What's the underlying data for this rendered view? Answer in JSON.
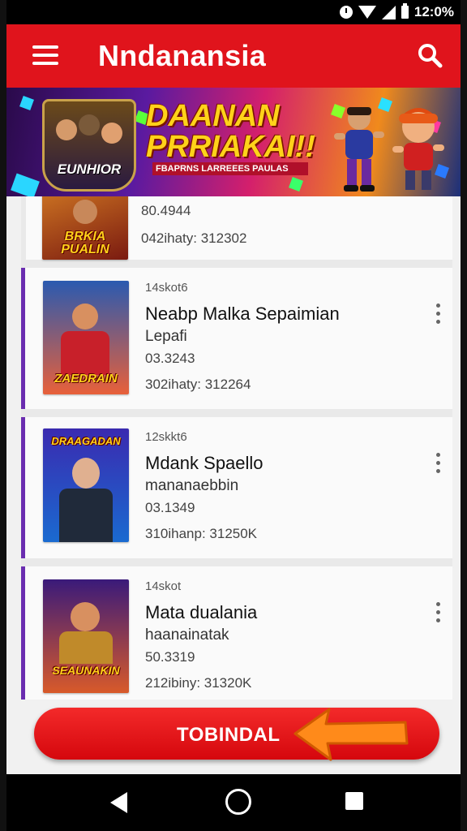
{
  "status_bar": {
    "time": "12:0%",
    "icons": [
      "clock-icon",
      "wifi-icon",
      "signal-icon",
      "battery-icon"
    ]
  },
  "app_bar": {
    "title": "Nndanansia",
    "menu_icon": "hamburger-menu-icon",
    "search_icon": "search-icon",
    "color": "#e0141c"
  },
  "banner": {
    "headline_line1": "DAANAN",
    "headline_line2": "PRRIAKAI!!",
    "subtitle": "FBAPRNS LARREEES PAULAS",
    "badge_text": "EUNHIOR"
  },
  "list": {
    "items": [
      {
        "thumb_title": "BRKIA PUALIN",
        "value": "80.4944",
        "stat": "042ihaty:  312302"
      },
      {
        "meta": "14skot6",
        "title": "Neabp Malka Sepaimian",
        "subtitle": "Lepafi",
        "value": "03.3243",
        "stat": "302ihaty:  312264",
        "thumb_title": "ZAEDRAIN"
      },
      {
        "meta": "12skkt6",
        "title": "Mdank Spaello",
        "subtitle": "mananaebbin",
        "value": "03.1349",
        "stat": "310ihanp:  31250K",
        "thumb_title": "DRAAGADAN"
      },
      {
        "meta": "14skot",
        "title": "Mata dualania",
        "subtitle": "haanainatak",
        "value": "50.3319",
        "stat": "212ibiny:  31320K",
        "thumb_title": "SEAUNAKIN"
      }
    ]
  },
  "cta": {
    "label": "TOBINDAL"
  },
  "nav_bar": {
    "back_icon": "back-triangle-icon",
    "home_icon": "home-circle-icon",
    "recent_icon": "recent-apps-square-icon"
  }
}
